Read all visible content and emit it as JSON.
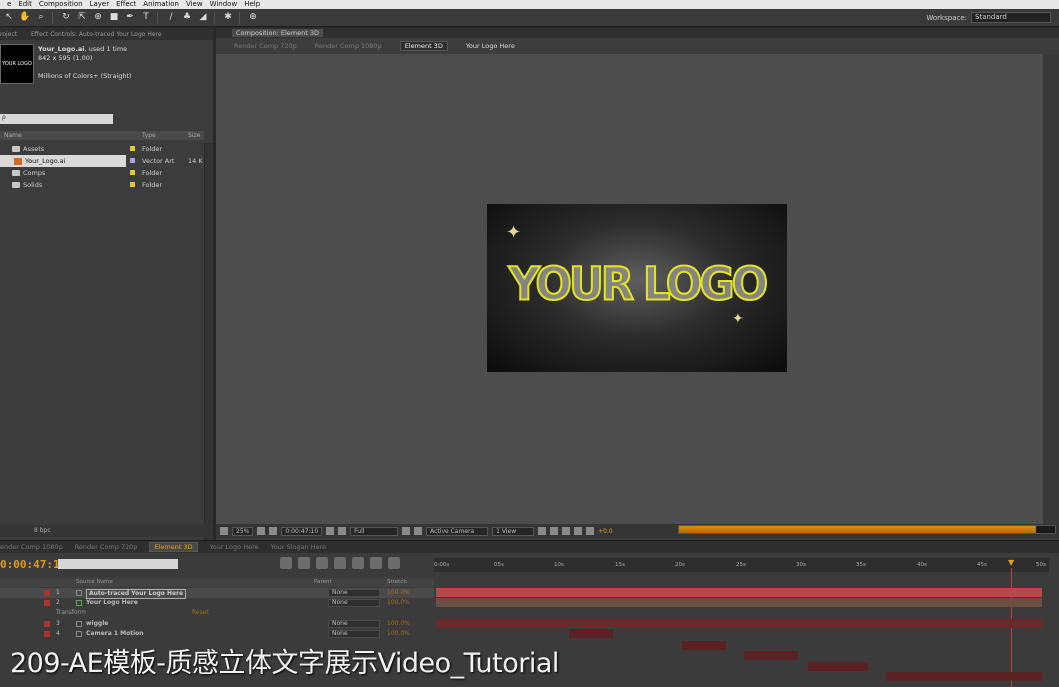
{
  "menu": [
    "e",
    "Edit",
    "Composition",
    "Layer",
    "Effect",
    "Animation",
    "View",
    "Window",
    "Help"
  ],
  "workspace": {
    "label": "Workspace:",
    "value": "Standard"
  },
  "project": {
    "tabs": [
      "roject",
      "Effect Controls: Auto-traced Your Logo Here"
    ],
    "thumb_text": "YOUR LOGO",
    "file_name": "Your_Logo.ai",
    "file_used": ", used 1 time",
    "file_dims": "842 x 595 (1.00)",
    "file_colors": "Millions of Colors+ (Straight)",
    "search_placeholder": "ρ",
    "columns": {
      "name": "Name",
      "type": "Type",
      "size": "Size"
    },
    "rows": [
      {
        "name": "Assets",
        "type": "Folder",
        "size": "",
        "color": "#e2c92b"
      },
      {
        "name": "Your_Logo.ai",
        "type": "Vector Art",
        "size": "14 K",
        "color": "#a8a8d8"
      },
      {
        "name": "Comps",
        "type": "Folder",
        "size": "",
        "color": "#e2c92b"
      },
      {
        "name": "Solids",
        "type": "Folder",
        "size": "",
        "color": "#e2c92b"
      }
    ],
    "footer": "8 bpc"
  },
  "composition": {
    "tab": "Composition: Element 3D",
    "flow": [
      "Render Comp 720p",
      "Render Comp 1080p",
      "Element 3D",
      "Your Logo Here"
    ],
    "logo_text": "YOUR LOGO",
    "zoom": "25%",
    "time": "0:00:47:10",
    "resolution": "Full",
    "camera": "Active Camera",
    "views": "1 View",
    "exposure": "+0.0",
    "render_progress": 0.95
  },
  "timeline": {
    "tabs": [
      "ender Comp 1080p",
      "Render Comp 720p",
      "Element 3D",
      "Your Logo Here",
      "Your Slogan Here"
    ],
    "timecode": "0:00:47:10",
    "columns": {
      "source": "Source Name",
      "parent": "Parent",
      "stretch": "Stretch"
    },
    "ruler": [
      "0:00s",
      "05s",
      "10s",
      "15s",
      "20s",
      "25s",
      "30s",
      "35s",
      "40s",
      "45s",
      "50s"
    ],
    "layers": [
      {
        "num": "1",
        "name": "Auto-traced Your Logo Here",
        "parent": "None",
        "stretch": "100.0%",
        "color": "#b03030"
      },
      {
        "num": "2",
        "name": "Your Logo Here",
        "parent": "None",
        "stretch": "100.0%",
        "color": "#b03030"
      },
      {
        "num": "",
        "name": "Transform",
        "parent": "",
        "stretch": "",
        "color": ""
      },
      {
        "num": "3",
        "name": "wiggle",
        "parent": "None",
        "stretch": "100.0%",
        "color": "#b03030"
      },
      {
        "num": "4",
        "name": "Camera 1 Motion",
        "parent": "None",
        "stretch": "100.0%",
        "color": "#b03030"
      }
    ],
    "reset_label": "Reset"
  },
  "caption": "209-AE模板-质感立体文字展示Video_Tutorial"
}
